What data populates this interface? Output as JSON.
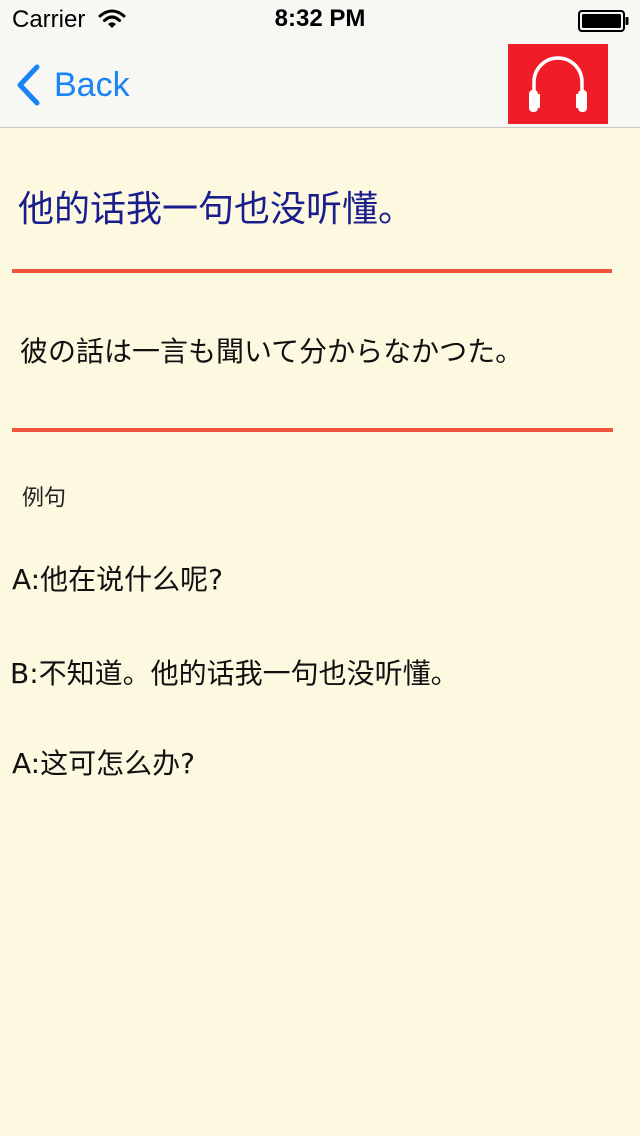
{
  "status_bar": {
    "carrier": "Carrier",
    "time": "8:32 PM",
    "icons": [
      "wifi-icon",
      "battery-icon"
    ]
  },
  "nav": {
    "back_label": "Back",
    "back_icon": "chevron-left-icon",
    "audio_icon": "headphones-icon",
    "accent_color": "#1a84f7",
    "audio_button_color": "#ef1d27"
  },
  "phrase": {
    "chinese": "他的话我一句也没听懂。",
    "japanese": "彼の話は一言も聞いて分からなかつた。"
  },
  "examples": {
    "heading": "例句",
    "lines": [
      "A:他在说什么呢?",
      "B:不知道。他的话我一句也没听懂。",
      "A:这可怎么办?"
    ]
  },
  "colors": {
    "background": "#fdf9e1",
    "divider": "#f2543b",
    "chinese_text": "#1a1e8c"
  }
}
